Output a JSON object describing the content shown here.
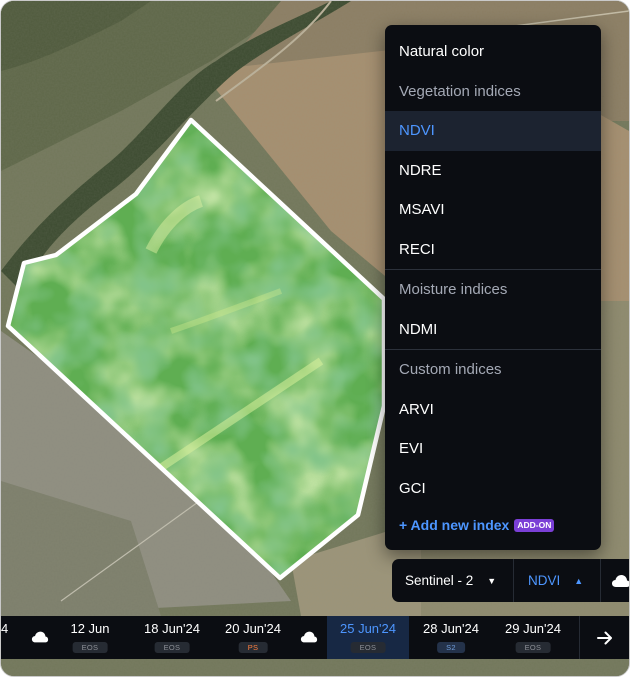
{
  "index_menu": {
    "items": [
      {
        "kind": "option",
        "label": "Natural color"
      },
      {
        "kind": "header",
        "label": "Vegetation indices"
      },
      {
        "kind": "option",
        "label": "NDVI",
        "selected": true
      },
      {
        "kind": "option",
        "label": "NDRE"
      },
      {
        "kind": "option",
        "label": "MSAVI"
      },
      {
        "kind": "option",
        "label": "RECI"
      },
      {
        "kind": "separator"
      },
      {
        "kind": "header",
        "label": "Moisture indices"
      },
      {
        "kind": "option",
        "label": "NDMI"
      },
      {
        "kind": "separator"
      },
      {
        "kind": "header",
        "label": "Custom indices"
      },
      {
        "kind": "option",
        "label": "ARVI"
      },
      {
        "kind": "option",
        "label": "EVI"
      },
      {
        "kind": "option",
        "label": "GCI"
      }
    ],
    "add_index_label": "+ Add new index",
    "add_on_badge": "ADD-ON"
  },
  "selector": {
    "satellite": "Sentinel - 2",
    "index": "NDVI",
    "satellite_icon": "chevron-down-icon",
    "index_icon": "chevron-up-icon",
    "cloud_icon": "cloud-icon"
  },
  "timeline": {
    "partial_label": "4",
    "items": [
      {
        "type": "cloud"
      },
      {
        "type": "date",
        "date": "12 Jun",
        "badge": "EOS"
      },
      {
        "type": "date",
        "date": "18 Jun'24",
        "badge": "EOS"
      },
      {
        "type": "date",
        "date": "20 Jun'24",
        "badge": "PS"
      },
      {
        "type": "cloud"
      },
      {
        "type": "date",
        "date": "25 Jun'24",
        "badge": "EOS",
        "active": true
      },
      {
        "type": "date",
        "date": "28 Jun'24",
        "badge": "S2"
      },
      {
        "type": "date",
        "date": "29 Jun'24",
        "badge": "EOS"
      }
    ],
    "next_icon": "arrow-right-icon"
  },
  "colors": {
    "accent": "#4d96ff",
    "panel": "#0b0d12",
    "add_on": "#7b3fd6",
    "ps_badge": "#ff7f3f",
    "field_outline": "#ffffff"
  }
}
